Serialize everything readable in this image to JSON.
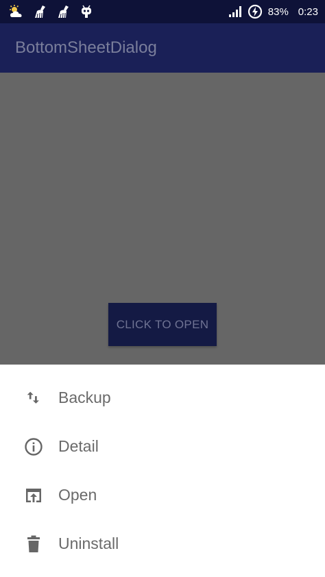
{
  "status_bar": {
    "battery_percent": "83%",
    "time": "0:23",
    "left_icons": [
      "weather-icon",
      "broom-icon",
      "broom-icon",
      "android-robot-icon"
    ],
    "right_icons": [
      "signal-icon",
      "battery-saver-icon"
    ]
  },
  "app_bar": {
    "title": "BottomSheetDialog"
  },
  "main": {
    "open_button_label": "CLICK TO OPEN"
  },
  "sheet": {
    "items": [
      {
        "label": "Backup",
        "icon": "swap-vert-icon"
      },
      {
        "label": "Detail",
        "icon": "info-icon"
      },
      {
        "label": "Open",
        "icon": "open-in-browser-icon"
      },
      {
        "label": "Uninstall",
        "icon": "trash-icon"
      }
    ]
  },
  "colors": {
    "status_bar": "#0e1238",
    "app_bar": "#1a2057",
    "scrim": "#666666",
    "button": "#141a44",
    "sheet_background": "#ffffff",
    "sheet_text": "#6a6a6a"
  }
}
